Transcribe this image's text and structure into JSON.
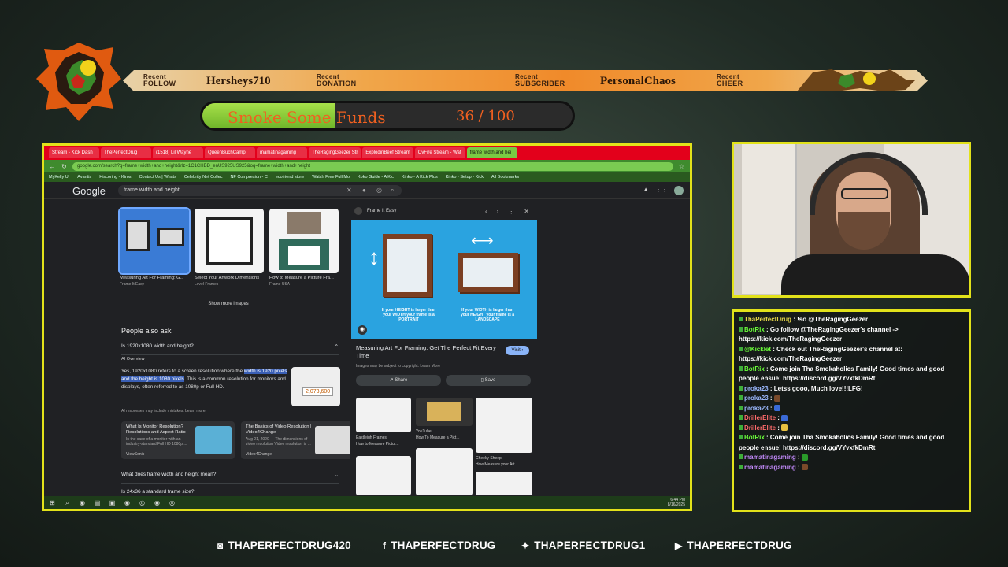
{
  "alerts": [
    {
      "label_top": "Recent",
      "label_bottom": "FOLLOW",
      "name": "Hersheys710"
    },
    {
      "label_top": "Recent",
      "label_bottom": "DONATION",
      "name": ""
    },
    {
      "label_top": "Recent",
      "label_bottom": "SUBSCRIBER",
      "name": "PersonalChaos"
    },
    {
      "label_top": "Recent",
      "label_bottom": "CHEER",
      "name": ""
    }
  ],
  "goal": {
    "title": "Smoke Some Funds",
    "count": "36 / 100",
    "progress": 0.36
  },
  "browser": {
    "tabs": [
      "Stream - Kick Dash",
      "ThePerfectDrug",
      "(1518) Lil Wayne",
      "QueenBuchCamp",
      "mamatinagaming",
      "TheRagingGeezer Str",
      "ExplodinBeef Stream",
      "OvFire Stream - Wat",
      "frame width and hei"
    ],
    "url": "google.com/search?q=frame+width+and+height&rlz=1C1CHBD_enUS925US925&oq=frame+width+and+height",
    "bookmarks": [
      "MyKelly UI",
      "Avantis",
      "Hiscoring - Kiros",
      "Contact Us | Whats",
      "Celebrity Net Collec",
      "NF Compresion - C",
      "ecofriend store",
      "Watch Free Full Mo",
      "Koko Guide - A Kic",
      "Kinko - A Kick Plus",
      "Kinko - Setup - Kick",
      "All Bookmarks"
    ],
    "google_logo": "Google",
    "search_query": "frame width and height",
    "images": [
      {
        "caption": "Measuring Art For Framing: G...",
        "source": "Frame It Easy"
      },
      {
        "caption": "Select Your Artwork Dimensions",
        "source": "Level Frames"
      },
      {
        "caption": "How to Measure a Picture Fra...",
        "source": "Frame USA"
      }
    ],
    "show_more": "Show more images",
    "paa_title": "People also ask",
    "q1": "Is 1920x1080 width and height?",
    "ai_overview": "AI Overview",
    "ai_text_pre": "Yes, 1920x1080 refers to a screen resolution where the ",
    "ai_text_hl": "width is 1920 pixels and the height is 1080 pixels",
    "ai_text_post": ". This is a common resolution for monitors and displays, often referred to as 1080p or Full HD.",
    "ai_thumb_number": "2,073,600",
    "ai_note": "AI responses may include mistakes. Learn more",
    "cards": [
      {
        "title": "What Is Monitor Resolution? Resolutions and Aspect Ratio",
        "desc": "In the case of a monitor with an industry-standard Full HD 1080p ...",
        "source": "ViewSonic"
      },
      {
        "title": "The Basics of Video Resolution | Video4Change",
        "desc": "Aug 21, 2020 — The dimensions of video resolution Video resolution is ...",
        "source": "Video4Change"
      }
    ],
    "q2": "What does frame width and height mean?",
    "q3": "Is 24x36 a standard frame size?",
    "panel": {
      "source": "Frame It Easy",
      "caption_left": "If your HEIGHT is larger than your WIDTH your frame is a PORTRAIT",
      "caption_right": "If your WIDTH is larger than your HEIGHT your frame is a LANDSCAPE",
      "title": "Measuring Art For Framing: Get The Perfect Fit Every Time",
      "visit": "Visit",
      "copyright": "Images may be subject to copyright. Learn More",
      "share": "Share",
      "save": "Save",
      "related": [
        {
          "source": "Eastleigh Frames",
          "caption": "How to Measure Pictur..."
        },
        {
          "source": "YouTube",
          "caption": "How To Measure a Pict..."
        },
        {
          "source": "Cheeky Sheep",
          "caption": "How Measure your Art ..."
        }
      ]
    },
    "clock_time": "6:44 PM",
    "clock_date": "8/16/2025"
  },
  "chat": [
    {
      "user": "ThaPerfectDrug",
      "user_color": "#e7d84a",
      "text": " : !so @TheRagingGeezer"
    },
    {
      "user": "BotRix",
      "user_color": "#6cff3a",
      "text": " : Go follow @TheRagingGeezer's channel -> https://kick.com/TheRagingGeezer"
    },
    {
      "user": "@Kicklet",
      "user_color": "#6cff3a",
      "text": " : Check out TheRagingGeezer's channel at: https://kick.com/TheRagingGeezer"
    },
    {
      "user": "BotRix",
      "user_color": "#6cff3a",
      "text": " : Come join Tha Smokaholics Family! Good times and good people ensue! https://discord.gg/VYvxfkDmRt"
    },
    {
      "user": "proka23",
      "user_color": "#9bb8ff",
      "text": " : Letss gooo, Much love!!!LFG!"
    },
    {
      "user": "proka23",
      "user_color": "#9bb8ff",
      "text": " : "
    },
    {
      "user": "proka23",
      "user_color": "#9bb8ff",
      "text": " : "
    },
    {
      "user": "DrillerElite",
      "user_color": "#ff6b6b",
      "text": " : "
    },
    {
      "user": "DrillerElite",
      "user_color": "#ff6b6b",
      "text": " : "
    },
    {
      "user": "BotRix",
      "user_color": "#6cff3a",
      "text": " : Come join Tha Smokaholics Family! Good times and good people ensue! https://discord.gg/VYvxfkDmRt"
    },
    {
      "user": "mamatinagaming",
      "user_color": "#c68cff",
      "text": " : "
    },
    {
      "user": "mamatinagaming",
      "user_color": "#c68cff",
      "text": " : "
    }
  ],
  "socials": [
    {
      "icon": "instagram-icon",
      "glyph": "◙",
      "handle": "THAPERFECTDRUG420"
    },
    {
      "icon": "facebook-icon",
      "glyph": "f",
      "handle": "THAPERFECTDRUG"
    },
    {
      "icon": "twitter-icon",
      "glyph": "✦",
      "handle": "THAPERFECTDRUG1"
    },
    {
      "icon": "youtube-icon",
      "glyph": "▶",
      "handle": "THAPERFECTDRUG"
    }
  ]
}
